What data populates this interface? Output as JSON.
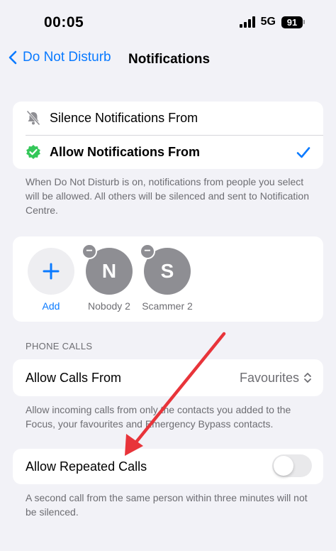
{
  "status_bar": {
    "time": "00:05",
    "network": "5G",
    "battery": "91",
    "signal_icon": "cellular-signal-icon"
  },
  "nav": {
    "back_label": "Do Not Disturb",
    "title": "Notifications"
  },
  "notifications_group": {
    "silence_label": "Silence Notifications From",
    "allow_label": "Allow Notifications From",
    "selected": "allow"
  },
  "notifications_footnote": "When Do Not Disturb is on, notifications from people you select will be allowed. All others will be silenced and sent to Notification Centre.",
  "contacts": {
    "add_label": "Add",
    "people": [
      {
        "initial": "N",
        "name": "Nobody 2"
      },
      {
        "initial": "S",
        "name": "Scammer 2"
      }
    ]
  },
  "phone_calls": {
    "header": "PHONE CALLS",
    "allow_calls_label": "Allow Calls From",
    "allow_calls_value": "Favourites",
    "allow_calls_footnote": "Allow incoming calls from only the contacts you added to the Focus, your favourites and Emergency Bypass contacts.",
    "repeated_calls_label": "Allow Repeated Calls",
    "repeated_calls_on": false,
    "repeated_calls_footnote": "A second call from the same person within three minutes will not be silenced."
  },
  "colors": {
    "accent": "#0a7aff",
    "annotation_arrow": "#e8343a",
    "verified_badge": "#34c759"
  }
}
